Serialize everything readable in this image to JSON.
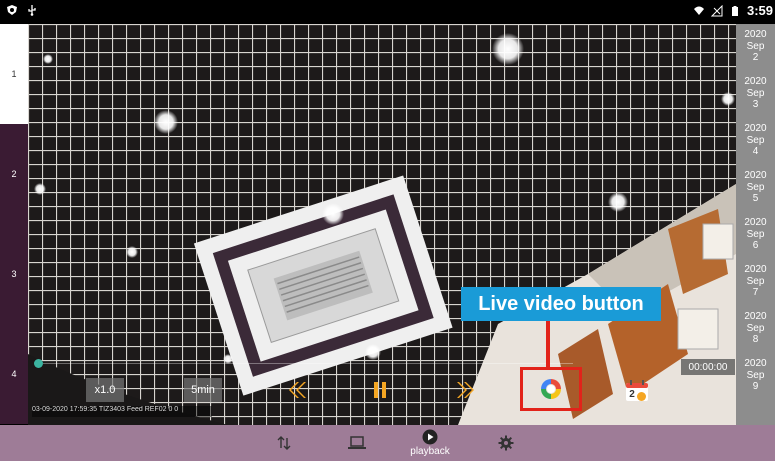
{
  "status_bar": {
    "time": "3:59",
    "left_icons": [
      "shield-icon",
      "usb-icon"
    ],
    "right_icons": [
      "wifi-icon",
      "signal-icon",
      "battery-icon"
    ]
  },
  "channels": [
    {
      "label": "1",
      "active": true
    },
    {
      "label": "2",
      "active": false
    },
    {
      "label": "3",
      "active": false
    },
    {
      "label": "4",
      "active": false
    }
  ],
  "dates": [
    {
      "year": "2020",
      "month": "Sep",
      "day": "2"
    },
    {
      "year": "2020",
      "month": "Sep",
      "day": "3"
    },
    {
      "year": "2020",
      "month": "Sep",
      "day": "4"
    },
    {
      "year": "2020",
      "month": "Sep",
      "day": "5"
    },
    {
      "year": "2020",
      "month": "Sep",
      "day": "6"
    },
    {
      "year": "2020",
      "month": "Sep",
      "day": "7"
    },
    {
      "year": "2020",
      "month": "Sep",
      "day": "8"
    },
    {
      "year": "2020",
      "month": "Sep",
      "day": "9"
    }
  ],
  "controls": {
    "speed_label": "x1.0",
    "duration_label": "5min",
    "time_display": "00:00:00",
    "calendar_badge": "2",
    "overlay_text": "03-09-2020 17:59:35 TIZ3403 Feed REF02 0 0"
  },
  "annotation": {
    "label": "Live video button",
    "color": "#e2231a",
    "label_bg": "#1a9bd7"
  },
  "bottom_nav": {
    "playback_label": "playback"
  },
  "colors": {
    "nav_bg": "#9e7c97",
    "channel_inactive": "#3a1b33",
    "date_bg": "#8d8d8d",
    "accent_orange": "#f5a623",
    "timeline": "#3cb4a0"
  }
}
